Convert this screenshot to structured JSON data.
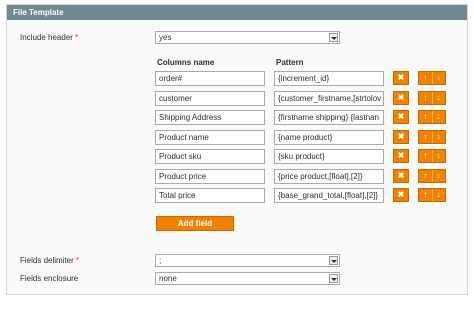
{
  "panel": {
    "title": "File Template"
  },
  "include_header": {
    "label": "Include header",
    "required_mark": "*",
    "value": "yes"
  },
  "columns": {
    "name_header": "Columns name",
    "pattern_header": "Pattern",
    "rows": [
      {
        "name": "order#",
        "pattern": "{increment_id}"
      },
      {
        "name": "customer",
        "pattern": "{customer_firstname,[strtolov"
      },
      {
        "name": "Shipping Address",
        "pattern": "{firstname shipping} {lastnan"
      },
      {
        "name": "Product name",
        "pattern": "{name product}"
      },
      {
        "name": "Product sku",
        "pattern": "{sku product}"
      },
      {
        "name": "Product price",
        "pattern": "{price product,[float],[2]}"
      },
      {
        "name": "Total price",
        "pattern": "{base_grand_total,[float],[2]}"
      }
    ],
    "delete_icon": "✖",
    "up_icon": "↑",
    "down_icon": "↓",
    "add_label": "Add field"
  },
  "fields_delimiter": {
    "label": "Fields delimiter",
    "required_mark": "*",
    "value": ";"
  },
  "fields_enclosure": {
    "label": "Fields enclosure",
    "value": "none"
  },
  "colors": {
    "header_bg": "#6f8992",
    "accent": "#f18200",
    "required": "#eb340a"
  }
}
